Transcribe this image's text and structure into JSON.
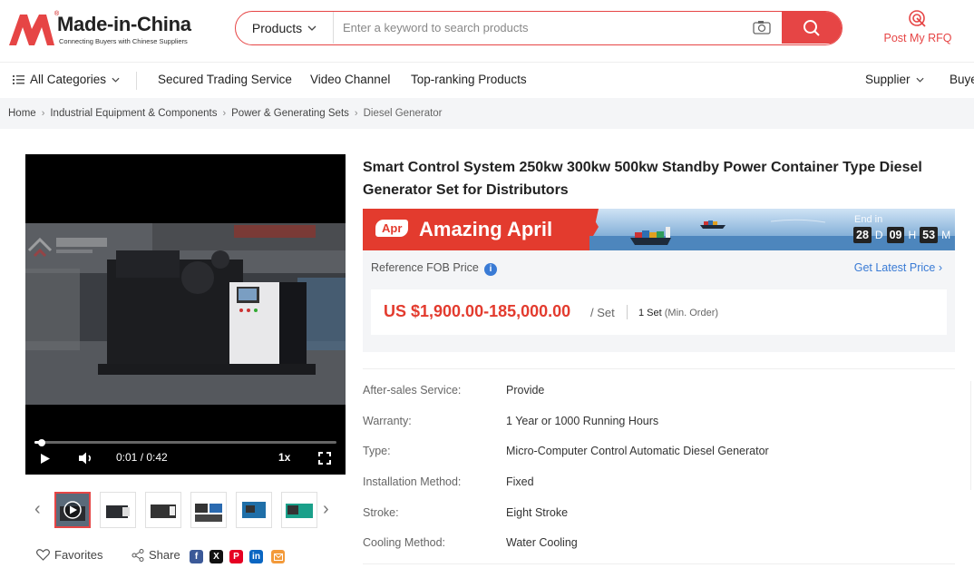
{
  "brand": {
    "name": "Made-in-China",
    "tagline": "Connecting Buyers with Chinese Suppliers",
    "registered": "®",
    "accent_color": "#e64545"
  },
  "search": {
    "category": "Products",
    "placeholder": "Enter a keyword to search products"
  },
  "header": {
    "rfq_label": "Post My RFQ"
  },
  "nav": {
    "all_categories": "All Categories",
    "items": [
      "Secured Trading Service",
      "Video Channel",
      "Top-ranking Products"
    ],
    "supplier": "Supplier",
    "buyer": "Buye"
  },
  "breadcrumb": [
    "Home",
    "Industrial Equipment & Components",
    "Power & Generating Sets",
    "Diesel Generator"
  ],
  "video": {
    "time": "0:01 / 0:42",
    "speed": "1x",
    "progress": 0.024
  },
  "social": {
    "favorites": "Favorites",
    "share": "Share"
  },
  "product": {
    "title": "Smart Control System 250kw 300kw 500kw Standby Power Container Type Diesel Generator Set for Distributors",
    "promo": {
      "tag": "Apr",
      "title": "Amazing April",
      "end_label": "End in",
      "days": "28",
      "hours": "09",
      "minutes": "53",
      "d": "D",
      "h": "H",
      "m": "M"
    },
    "price": {
      "ref_label": "Reference FOB Price",
      "latest_link": "Get Latest Price",
      "range": "US $1,900.00-185,000.00",
      "unit": "/ Set",
      "moq": "1 Set",
      "moq_note": "(Min. Order)"
    },
    "specs": [
      {
        "key": "After-sales Service:",
        "value": "Provide"
      },
      {
        "key": "Warranty:",
        "value": "1 Year or 1000 Running Hours"
      },
      {
        "key": "Type:",
        "value": "Micro-Computer Control Automatic Diesel Generator"
      },
      {
        "key": "Installation Method:",
        "value": "Fixed"
      },
      {
        "key": "Stroke:",
        "value": "Eight Stroke"
      },
      {
        "key": "Cooling Method:",
        "value": "Water Cooling"
      }
    ]
  }
}
